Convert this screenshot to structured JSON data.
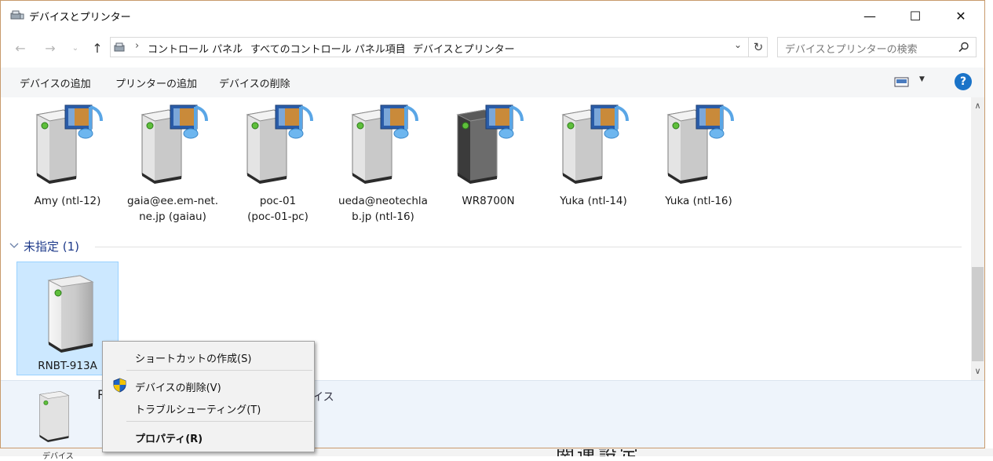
{
  "window": {
    "title": "デバイスとプリンター",
    "controls": {
      "minimize": "—",
      "maximize": "☐",
      "close": "✕"
    }
  },
  "address": {
    "crumbs": [
      "コントロール パネル",
      "すべてのコントロール パネル項目",
      "デバイスとプリンター"
    ],
    "search_placeholder": "デバイスとプリンターの検索"
  },
  "commands": [
    "デバイスの追加",
    "プリンターの追加",
    "デバイスの削除"
  ],
  "help_label": "?",
  "devices": [
    {
      "label": "Amy (ntl-12)",
      "icon": "media-server-icon"
    },
    {
      "label": "gaia@ee.em-net.ne.jp (gaiau)",
      "icon": "media-server-icon"
    },
    {
      "label": "poc-01 (poc-01-pc)",
      "icon": "media-server-icon"
    },
    {
      "label": "ueda@neotechlab.jp (ntl-16)",
      "icon": "media-server-icon"
    },
    {
      "label": "WR8700N",
      "icon": "media-router-icon"
    },
    {
      "label": "Yuka (ntl-14)",
      "icon": "media-server-icon"
    },
    {
      "label": "Yuka (ntl-16)",
      "icon": "media-server-icon"
    }
  ],
  "device_label_lines": [
    [
      "Amy (ntl-12)"
    ],
    [
      "gaia@ee.em-net.",
      "ne.jp (gaiau)"
    ],
    [
      "poc-01",
      "(poc-01-pc)"
    ],
    [
      "ueda@neotechla",
      "b.jp (ntl-16)"
    ],
    [
      "WR8700N"
    ],
    [
      "Yuka (ntl-14)"
    ],
    [
      "Yuka (ntl-16)"
    ]
  ],
  "unspecified_group": {
    "header": "未指定 (1)",
    "device": {
      "label": "RNBT-913A",
      "icon": "storage-device-icon"
    }
  },
  "details_pane": {
    "name_partial": "R",
    "category_partial": "イス"
  },
  "background_text": {
    "left": "デバイス",
    "right": "関連設定"
  },
  "context_menu": {
    "items": [
      {
        "label": "ショートカットの作成(S)"
      },
      {
        "label": "デバイスの削除(V)",
        "icon": "uac-shield-icon"
      },
      {
        "label": "トラブルシューティング(T)"
      },
      {
        "label": "プロパティ(R)",
        "bold": true
      }
    ]
  }
}
